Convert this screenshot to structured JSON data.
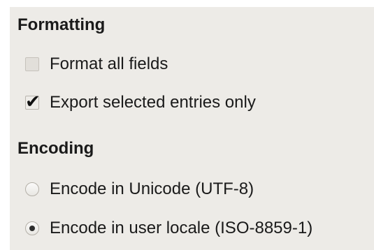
{
  "formatting": {
    "title": "Formatting",
    "options": [
      {
        "label": "Format all fields",
        "checked": false
      },
      {
        "label": "Export selected entries only",
        "checked": true
      }
    ]
  },
  "encoding": {
    "title": "Encoding",
    "options": [
      {
        "label": "Encode in Unicode (UTF-8)",
        "selected": false
      },
      {
        "label": "Encode in user locale (ISO-8859-1)",
        "selected": true
      }
    ]
  },
  "icons": {
    "checkbox_checked": "checkmark-icon",
    "radio_selected": "radio-dot-icon"
  },
  "colors": {
    "panel_background": "#edebe7",
    "page_background": "#ffffff",
    "text": "#1a1a1a"
  }
}
